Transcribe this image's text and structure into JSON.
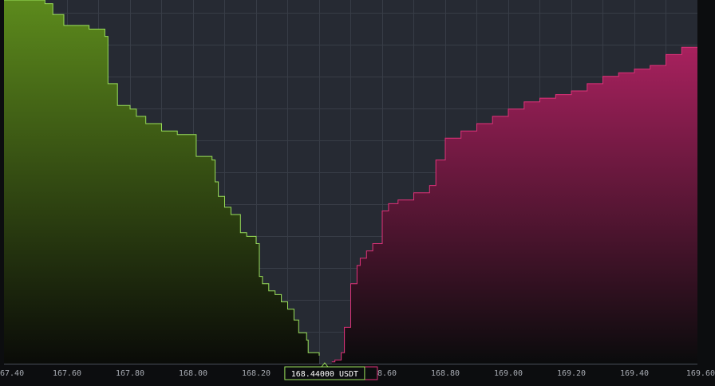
{
  "chart_data": {
    "type": "area",
    "title": "",
    "xlabel": "",
    "ylabel": "",
    "xlim": [
      167.4,
      169.6
    ],
    "ylim": [
      0,
      1
    ],
    "grid": true,
    "x_ticks": [
      "67.40",
      "167.60",
      "167.80",
      "168.00",
      "168.20",
      "168.40",
      "168.60",
      "168.80",
      "169.00",
      "169.20",
      "169.40",
      "169.60"
    ],
    "x_tick_values": [
      167.4,
      167.6,
      167.8,
      168.0,
      168.2,
      168.4,
      168.6,
      168.8,
      169.0,
      169.2,
      169.4,
      169.6
    ],
    "mid_price_label": "168.44000 USDT",
    "colors": {
      "background": "#262a33",
      "grid": "#383d47",
      "bid_line": "#9ae05a",
      "bid_fill_top": "#5c8a1c",
      "bid_fill_bottom": "#0a0b08",
      "ask_line": "#e0327a",
      "ask_fill_top": "#a8215e",
      "ask_fill_bottom": "#0a0b0c"
    },
    "series": [
      {
        "side": "bid",
        "x": [
          167.4,
          167.52,
          167.53,
          167.555,
          167.59,
          167.6,
          167.63,
          167.67,
          167.71,
          167.72,
          167.73,
          167.76,
          167.8,
          167.82,
          167.85,
          167.9,
          167.95,
          167.98,
          168.0,
          168.01,
          168.03,
          168.06,
          168.07,
          168.08,
          168.1,
          168.12,
          168.15,
          168.17,
          168.2,
          168.21,
          168.22,
          168.24,
          168.26,
          168.28,
          168.3,
          168.32,
          168.335,
          168.36,
          168.365,
          168.4
        ],
        "y": [
          1.0,
          1.0,
          0.99,
          0.96,
          0.93,
          0.93,
          0.93,
          0.92,
          0.92,
          0.9,
          0.77,
          0.71,
          0.7,
          0.68,
          0.66,
          0.64,
          0.63,
          0.63,
          0.63,
          0.57,
          0.57,
          0.56,
          0.5,
          0.46,
          0.43,
          0.41,
          0.36,
          0.35,
          0.33,
          0.24,
          0.22,
          0.2,
          0.19,
          0.17,
          0.15,
          0.12,
          0.085,
          0.065,
          0.03,
          0.022
        ]
      },
      {
        "side": "ask",
        "x": [
          168.44,
          168.45,
          168.47,
          168.48,
          168.5,
          168.52,
          168.53,
          168.55,
          168.57,
          168.6,
          168.62,
          168.65,
          168.7,
          168.75,
          168.77,
          168.8,
          168.85,
          168.9,
          168.95,
          169.0,
          169.05,
          169.1,
          169.15,
          169.2,
          169.25,
          169.3,
          169.35,
          169.4,
          169.45,
          169.5,
          169.55,
          169.6
        ],
        "y": [
          0.005,
          0.01,
          0.03,
          0.1,
          0.22,
          0.27,
          0.29,
          0.31,
          0.33,
          0.42,
          0.44,
          0.45,
          0.47,
          0.49,
          0.56,
          0.62,
          0.64,
          0.66,
          0.68,
          0.7,
          0.72,
          0.73,
          0.74,
          0.75,
          0.77,
          0.79,
          0.8,
          0.81,
          0.82,
          0.85,
          0.87,
          0.87
        ]
      }
    ]
  }
}
